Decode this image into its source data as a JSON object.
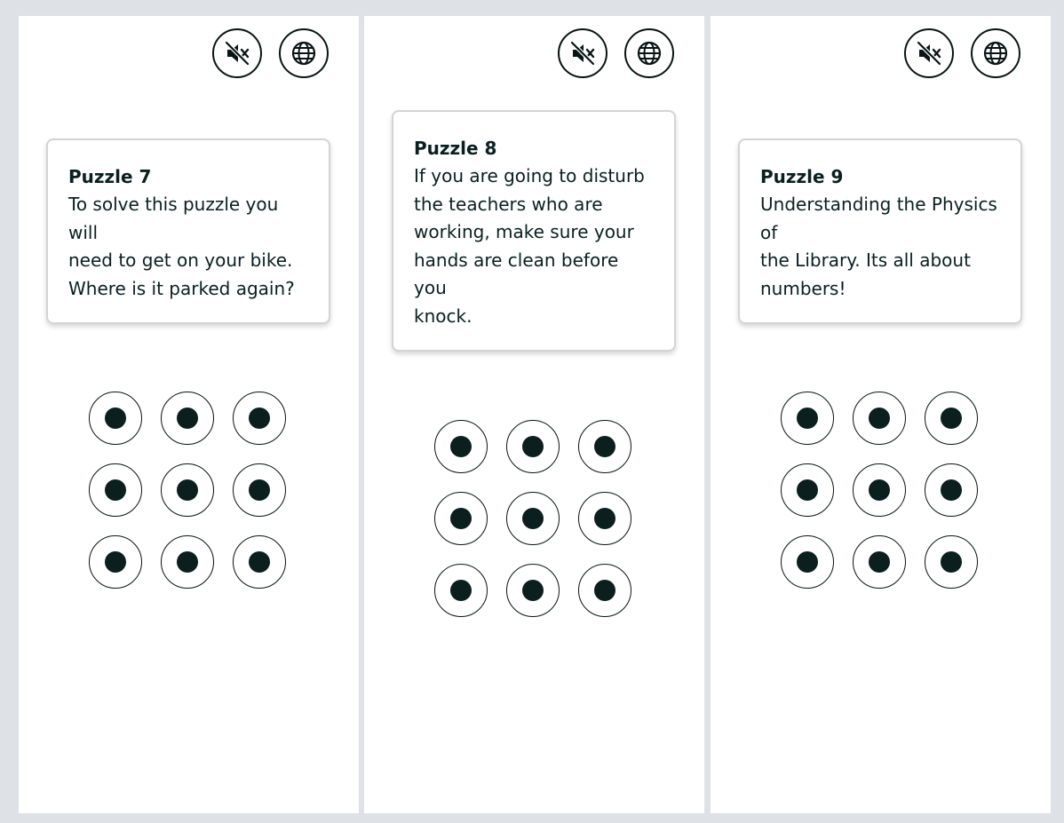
{
  "puzzles": [
    {
      "title": "Puzzle 7",
      "text": "To solve this puzzle you will\nneed to get on your bike.\nWhere is it parked again?",
      "mute_icon": "speaker-muted-icon",
      "globe_icon": "globe-icon"
    },
    {
      "title": "Puzzle 8",
      "text": "If you are going to disturb\nthe teachers who are\nworking, make sure your\nhands are clean before you\nknock.",
      "mute_icon": "speaker-muted-icon",
      "globe_icon": "globe-icon"
    },
    {
      "title": "Puzzle 9",
      "text": "Understanding the Physics of\nthe Library. Its all about\nnumbers!",
      "mute_icon": "speaker-muted-icon",
      "globe_icon": "globe-icon"
    }
  ],
  "colors": {
    "background": "#dee2e6",
    "panel": "#ffffff",
    "ink": "#0a1f1f",
    "card_border": "#d4d4d8"
  }
}
